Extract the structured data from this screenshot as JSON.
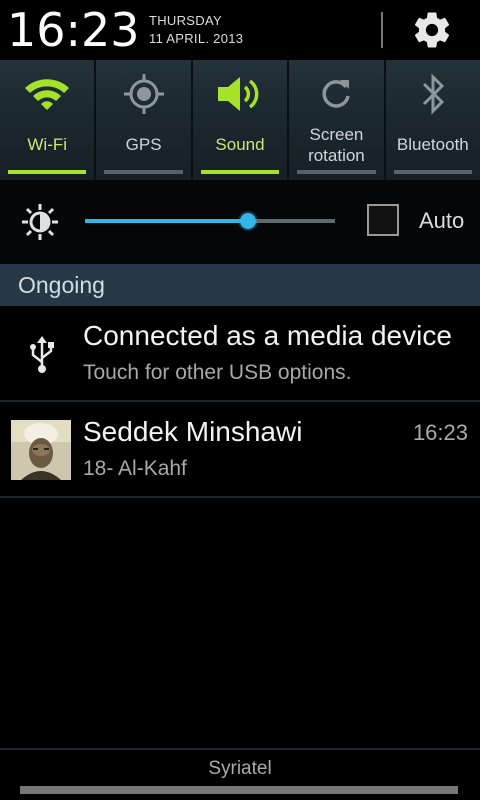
{
  "header": {
    "time": "16:23",
    "day": "THURSDAY",
    "date": "11 APRIL. 2013",
    "settings_icon": "gear-icon"
  },
  "toggles": [
    {
      "label": "Wi-Fi",
      "icon": "wifi-icon",
      "state": "on"
    },
    {
      "label": "GPS",
      "icon": "gps-icon",
      "state": "off"
    },
    {
      "label": "Sound",
      "icon": "speaker-icon",
      "state": "on"
    },
    {
      "label_line1": "Screen",
      "label_line2": "rotation",
      "icon": "rotation-icon",
      "state": "off"
    },
    {
      "label": "Bluetooth",
      "icon": "bluetooth-icon",
      "state": "off"
    }
  ],
  "brightness": {
    "icon": "brightness-icon",
    "level": 0.65,
    "auto_label": "Auto",
    "auto_checked": false
  },
  "section": {
    "title": "Ongoing"
  },
  "notifications": [
    {
      "icon": "usb-icon",
      "title": "Connected as a media device",
      "subtitle": "Touch for other USB options."
    },
    {
      "icon": "album-art",
      "title": "Seddek Minshawi",
      "subtitle": "18- Al-Kahf",
      "time": "16:23"
    }
  ],
  "footer": {
    "carrier": "Syriatel"
  },
  "colors": {
    "toggle_on": "#a6e22a",
    "slider_accent": "#33b5e5",
    "section_header_bg": "#263845"
  }
}
